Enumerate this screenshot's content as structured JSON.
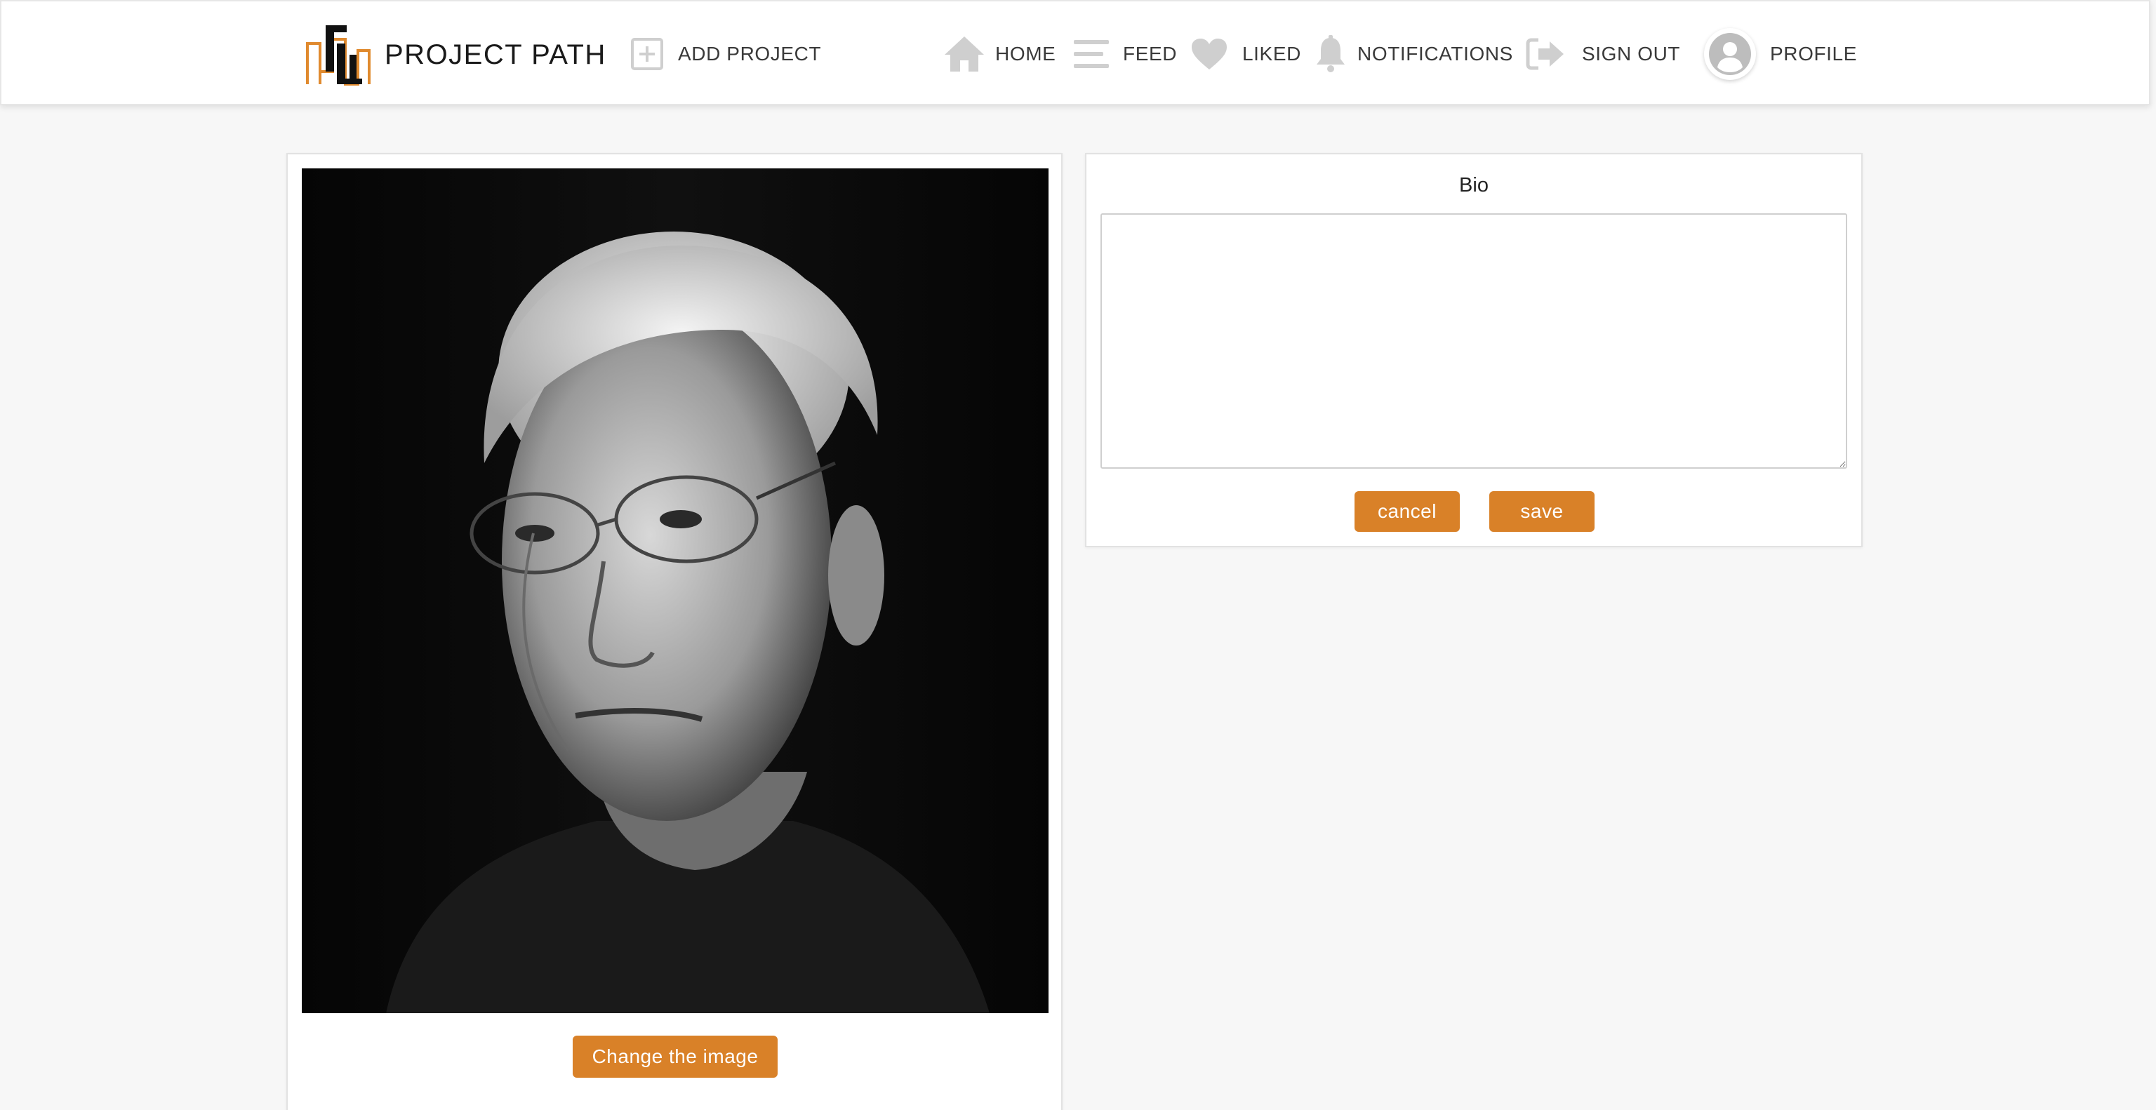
{
  "brand": {
    "name": "PROJECT PATH",
    "logo_icon": "project-path-logo",
    "colors": {
      "orange": "#e08a2e",
      "black": "#111111"
    }
  },
  "nav": {
    "add_project": {
      "label": "ADD PROJECT",
      "icon": "plus-square-icon"
    },
    "items": [
      {
        "label": "HOME",
        "icon": "home-icon"
      },
      {
        "label": "FEED",
        "icon": "list-icon"
      },
      {
        "label": "LIKED",
        "icon": "heart-icon"
      },
      {
        "label": "NOTIFICATIONS",
        "icon": "bell-icon"
      },
      {
        "label": "SIGN OUT",
        "icon": "sign-out-icon"
      },
      {
        "label": "PROFILE",
        "icon": "user-avatar-icon"
      }
    ],
    "icon_color": "#cfcfcf"
  },
  "profile_photo": {
    "button_label": "Change the image"
  },
  "bio": {
    "title": "Bio",
    "value": "",
    "cancel_label": "cancel",
    "save_label": "save"
  },
  "colors": {
    "accent": "#d98128",
    "page_background": "#f7f7f7"
  }
}
